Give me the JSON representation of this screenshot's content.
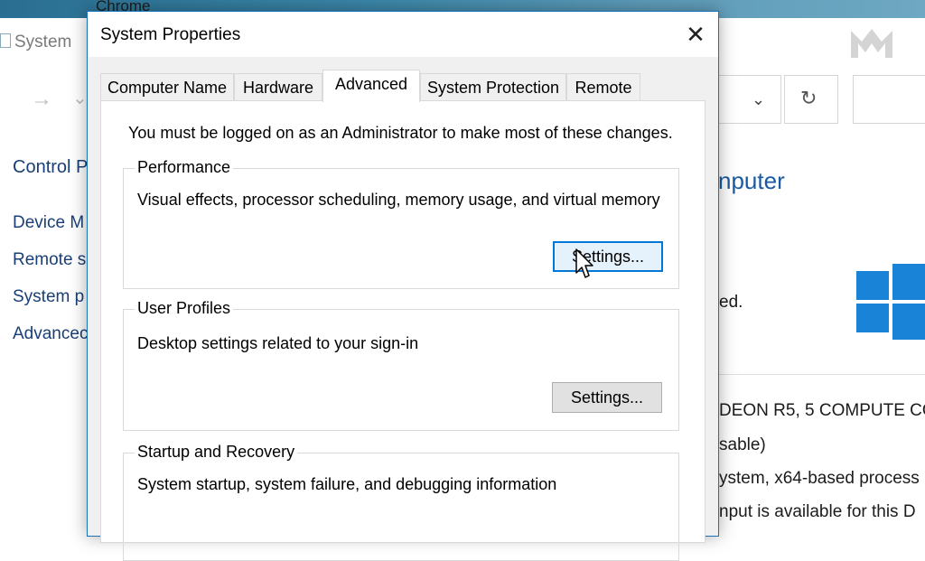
{
  "top_strip": {
    "chrome_label": "Chrome"
  },
  "background_window": {
    "title": "System",
    "sidebar_items": [
      "Control P",
      "Device M",
      "Remote s",
      "System p",
      "Advancec"
    ],
    "heading": "nputer",
    "texts": [
      "ed.",
      "DEON R5, 5 COMPUTE CO",
      "sable)",
      "ystem, x64-based process",
      "nput is available for this D"
    ],
    "chevron": "⌄",
    "refresh": "↻"
  },
  "dialog": {
    "title": "System Properties",
    "close_label": "✕",
    "tabs": [
      {
        "label": "Computer Name",
        "active": false
      },
      {
        "label": "Hardware",
        "active": false
      },
      {
        "label": "Advanced",
        "active": true
      },
      {
        "label": "System Protection",
        "active": false
      },
      {
        "label": "Remote",
        "active": false
      }
    ],
    "admin_note": "You must be logged on as an Administrator to make most of these changes.",
    "groups": {
      "performance": {
        "label": "Performance",
        "description": "Visual effects, processor scheduling, memory usage, and virtual memory",
        "button": "Settings..."
      },
      "user_profiles": {
        "label": "User Profiles",
        "description": "Desktop settings related to your sign-in",
        "button": "Settings..."
      },
      "startup_recovery": {
        "label": "Startup and Recovery",
        "description": "System startup, system failure, and debugging information"
      }
    }
  },
  "colors": {
    "accent": "#0078d7",
    "windows_logo": "#1883d7",
    "dialog_border": "#1a72b5"
  }
}
